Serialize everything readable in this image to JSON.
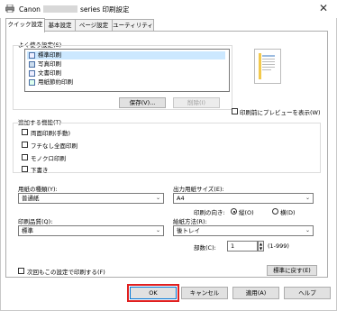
{
  "window": {
    "title_prefix": "Canon",
    "title_suffix": "series 印刷設定",
    "close_glyph": "✕"
  },
  "tabs": [
    "クイック設定",
    "基本設定",
    "ページ設定",
    "ユーティリティ"
  ],
  "quick_setup": {
    "favorites_label": "よく使う設定(S)",
    "favorites": [
      "標準印刷",
      "写真印刷",
      "文書印刷",
      "用紙節約印刷"
    ],
    "selected_index": 0,
    "save_button": "保存(V)...",
    "delete_button": "削除(I)",
    "preview_label": "印刷前にプレビューを表示(W)"
  },
  "additional": {
    "label": "追加する機能(T)",
    "items": [
      "両面印刷(手動)",
      "フチなし全面印刷",
      "モノクロ印刷",
      "下書き"
    ]
  },
  "media_type": {
    "label": "用紙の種類(Y):",
    "value": "普通紙"
  },
  "output_size": {
    "label": "出力用紙サイズ(E):",
    "value": "A4"
  },
  "orientation": {
    "label": "印刷の向き:",
    "portrait": "縦(O)",
    "landscape": "横(D)",
    "selected": "portrait"
  },
  "quality": {
    "label": "印刷品質(Q):",
    "value": "標準"
  },
  "paper_source": {
    "label": "給紙方法(R):",
    "value": "後トレイ"
  },
  "copies": {
    "label": "部数(C):",
    "value": "1",
    "range": "(1-999)"
  },
  "always_print": {
    "label": "次回もこの設定で印刷する(F)"
  },
  "defaults_button": "標準に戻す(E)",
  "footer": {
    "ok": "OK",
    "cancel": "キャンセル",
    "apply": "適用(A)",
    "help": "ヘルプ"
  }
}
